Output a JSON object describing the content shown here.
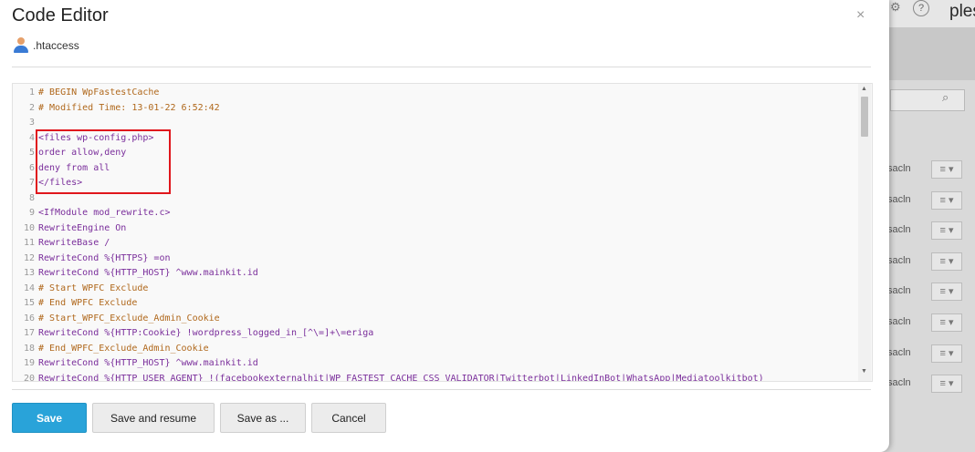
{
  "background_app": {
    "logo_text": "plesk",
    "help_icon": "?",
    "rows": [
      "sacln",
      "sacln",
      "sacln",
      "sacln",
      "sacln",
      "sacln",
      "sacln",
      "sacln"
    ]
  },
  "modal": {
    "title": "Code Editor",
    "file_name": ".htaccess",
    "close_glyph": "×"
  },
  "editor": {
    "lines": [
      {
        "n": "1",
        "text": "# BEGIN WpFastestCache",
        "type": "comment"
      },
      {
        "n": "2",
        "text": "# Modified Time: 13-01-22 6:52:42",
        "type": "comment"
      },
      {
        "n": "3",
        "text": "",
        "type": "plain"
      },
      {
        "n": "4",
        "text": "<files wp-config.php>",
        "type": "plain"
      },
      {
        "n": "5",
        "text": "order allow,deny",
        "type": "plain"
      },
      {
        "n": "6",
        "text": "deny from all",
        "type": "plain"
      },
      {
        "n": "7",
        "text": "</files>",
        "type": "plain"
      },
      {
        "n": "8",
        "text": "",
        "type": "plain"
      },
      {
        "n": "9",
        "text": "<IfModule mod_rewrite.c>",
        "type": "plain"
      },
      {
        "n": "10",
        "text": "RewriteEngine On",
        "type": "plain"
      },
      {
        "n": "11",
        "text": "RewriteBase /",
        "type": "plain"
      },
      {
        "n": "12",
        "text": "RewriteCond %{HTTPS} =on",
        "type": "plain"
      },
      {
        "n": "13",
        "text": "RewriteCond %{HTTP_HOST} ^www.mainkit.id",
        "type": "plain"
      },
      {
        "n": "14",
        "text": "# Start WPFC Exclude",
        "type": "comment"
      },
      {
        "n": "15",
        "text": "# End WPFC Exclude",
        "type": "comment"
      },
      {
        "n": "16",
        "text": "# Start_WPFC_Exclude_Admin_Cookie",
        "type": "comment"
      },
      {
        "n": "17",
        "text": "RewriteCond %{HTTP:Cookie} !wordpress_logged_in_[^\\=]+\\=eriga",
        "type": "plain"
      },
      {
        "n": "18",
        "text": "# End_WPFC_Exclude_Admin_Cookie",
        "type": "comment"
      },
      {
        "n": "19",
        "text": "RewriteCond %{HTTP_HOST} ^www.mainkit.id",
        "type": "plain"
      },
      {
        "n": "20",
        "text": "RewriteCond %{HTTP_USER_AGENT} !(facebookexternalhit|WP_FASTEST_CACHE_CSS_VALIDATOR|Twitterbot|LinkedInBot|WhatsApp|Mediatoolkitbot)",
        "type": "plain"
      }
    ]
  },
  "buttons": {
    "save": "Save",
    "save_resume": "Save and resume",
    "save_as": "Save as ...",
    "cancel": "Cancel"
  },
  "colors": {
    "primary": "#29a3d9",
    "highlight_box": "#e0161c",
    "comment": "#b0681c",
    "code": "#7a2e9b"
  }
}
